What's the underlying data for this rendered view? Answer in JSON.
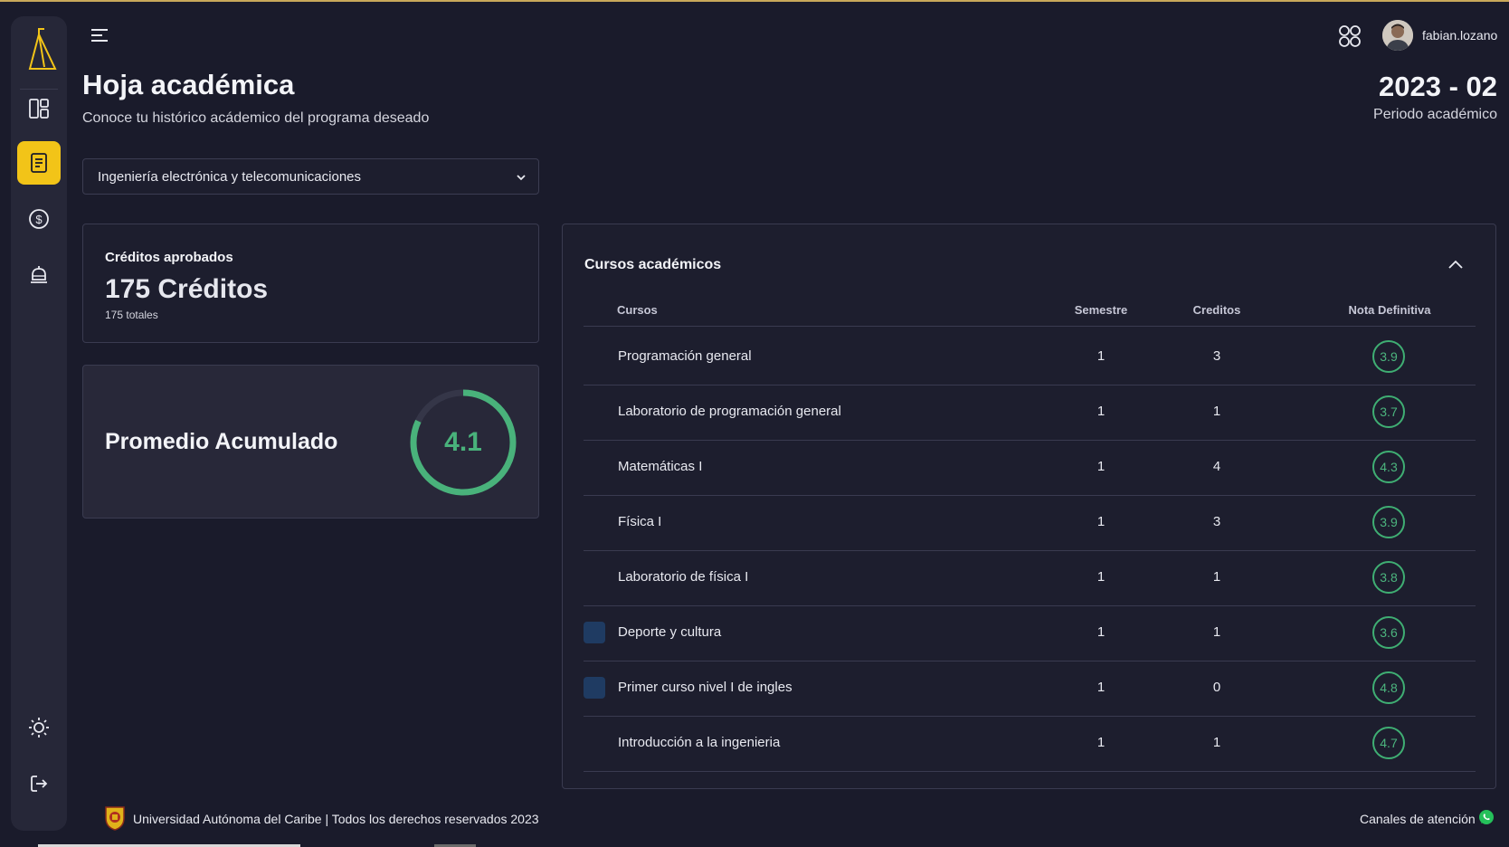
{
  "header": {
    "title": "Hoja académica",
    "subtitle": "Conoce tu histórico acádemico del programa deseado",
    "period_value": "2023 - 02",
    "period_label": "Periodo académico"
  },
  "user": {
    "username": "fabian.lozano"
  },
  "sidebar": {
    "items": [
      {
        "icon": "dashboard-icon"
      },
      {
        "icon": "document-icon",
        "active": true
      },
      {
        "icon": "dollar-icon"
      },
      {
        "icon": "bell-icon"
      },
      {
        "icon": "sun-icon"
      },
      {
        "icon": "logout-icon"
      }
    ]
  },
  "program_select": {
    "value": "Ingeniería electrónica y telecomunicaciones"
  },
  "credits": {
    "title": "Créditos aprobados",
    "value": "175 Créditos",
    "total": "175 totales"
  },
  "gpa": {
    "label": "Promedio Acumulado",
    "value": "4.1",
    "fraction": 0.82
  },
  "courses": {
    "title": "Cursos académicos",
    "columns": [
      "Cursos",
      "Semestre",
      "Creditos",
      "Nota Definitiva"
    ],
    "rows": [
      {
        "name": "Programación general",
        "semestre": "1",
        "creditos": "3",
        "nota": "3.9",
        "marker": false
      },
      {
        "name": "Laboratorio de programación general",
        "semestre": "1",
        "creditos": "1",
        "nota": "3.7",
        "marker": false
      },
      {
        "name": "Matemáticas I",
        "semestre": "1",
        "creditos": "4",
        "nota": "4.3",
        "marker": false
      },
      {
        "name": "Física I",
        "semestre": "1",
        "creditos": "3",
        "nota": "3.9",
        "marker": false
      },
      {
        "name": "Laboratorio de física I",
        "semestre": "1",
        "creditos": "1",
        "nota": "3.8",
        "marker": false
      },
      {
        "name": "Deporte y cultura",
        "semestre": "1",
        "creditos": "1",
        "nota": "3.6",
        "marker": true
      },
      {
        "name": "Primer curso nivel I de ingles",
        "semestre": "1",
        "creditos": "0",
        "nota": "4.8",
        "marker": true
      },
      {
        "name": "Introducción a la ingenieria",
        "semestre": "1",
        "creditos": "1",
        "nota": "4.7",
        "marker": false
      }
    ]
  },
  "footer": {
    "text": "Universidad Autónoma del Caribe | Todos los derechos reservados 2023",
    "channels": "Canales de atención"
  },
  "colors": {
    "accent": "#f2c418",
    "grade_green": "#4cb57e",
    "background": "#1a1b2b"
  }
}
